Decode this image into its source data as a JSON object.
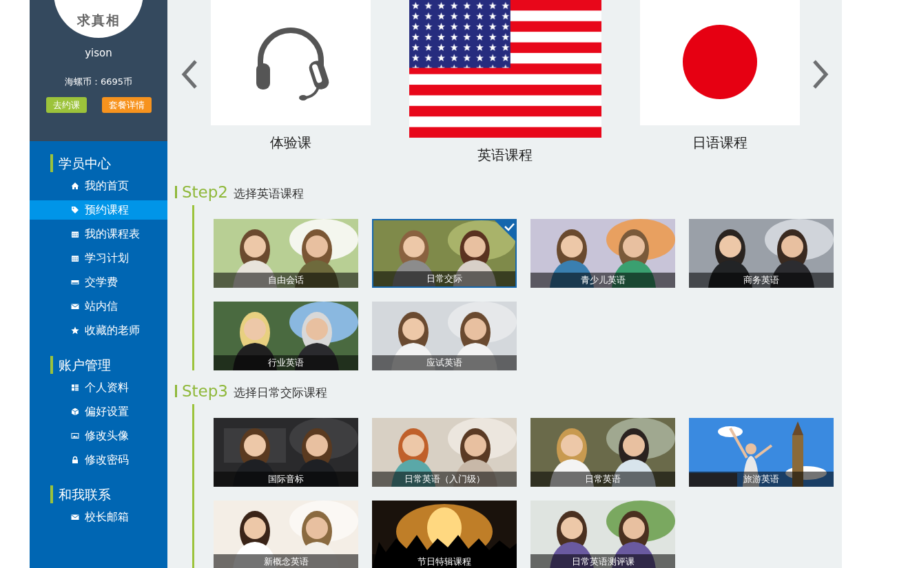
{
  "profile": {
    "avatar_text": "求真相",
    "username": "yison",
    "coins": "海螺币：6695币",
    "buttons": [
      {
        "label": "去约课",
        "kind": "primary"
      },
      {
        "label": "套餐详情",
        "kind": "secondary"
      }
    ]
  },
  "sidebar": {
    "sections": [
      {
        "title": "学员中心",
        "items": [
          {
            "label": "我的首页",
            "selected": false
          },
          {
            "label": "预约课程",
            "selected": true
          },
          {
            "label": "我的课程表",
            "selected": false
          },
          {
            "label": "学习计划",
            "selected": false
          },
          {
            "label": "交学费",
            "selected": false
          },
          {
            "label": "站内信",
            "selected": false
          },
          {
            "label": "收藏的老师",
            "selected": false
          }
        ]
      },
      {
        "title": "账户管理",
        "items": [
          {
            "label": "个人资料",
            "selected": false
          },
          {
            "label": "偏好设置",
            "selected": false
          },
          {
            "label": "修改头像",
            "selected": false
          },
          {
            "label": "修改密码",
            "selected": false
          }
        ]
      },
      {
        "title": "和我联系",
        "items": [
          {
            "label": "校长邮箱",
            "selected": false
          }
        ]
      }
    ]
  },
  "course_types": [
    {
      "label": "体验课",
      "selected": false
    },
    {
      "label": "英语课程",
      "selected": true
    },
    {
      "label": "日语课程",
      "selected": false
    }
  ],
  "steps": [
    {
      "step": "Step2",
      "title": "选择英语课程",
      "courses": [
        {
          "label": "自由会话",
          "selected": false
        },
        {
          "label": "日常交际",
          "selected": true
        },
        {
          "label": "青少儿英语",
          "selected": false
        },
        {
          "label": "商务英语",
          "selected": false
        },
        {
          "label": "行业英语",
          "selected": false
        },
        {
          "label": "应试英语",
          "selected": false
        }
      ]
    },
    {
      "step": "Step3",
      "title": "选择日常交际课程",
      "courses": [
        {
          "label": "国际音标",
          "selected": false
        },
        {
          "label": "日常英语（入门级）",
          "selected": false
        },
        {
          "label": "日常英语",
          "selected": false
        },
        {
          "label": "旅游英语",
          "selected": false
        },
        {
          "label": "新概念英语",
          "selected": false
        },
        {
          "label": "节日特辑课程",
          "selected": false
        },
        {
          "label": "日常英语测评课",
          "selected": false
        }
      ]
    }
  ]
}
